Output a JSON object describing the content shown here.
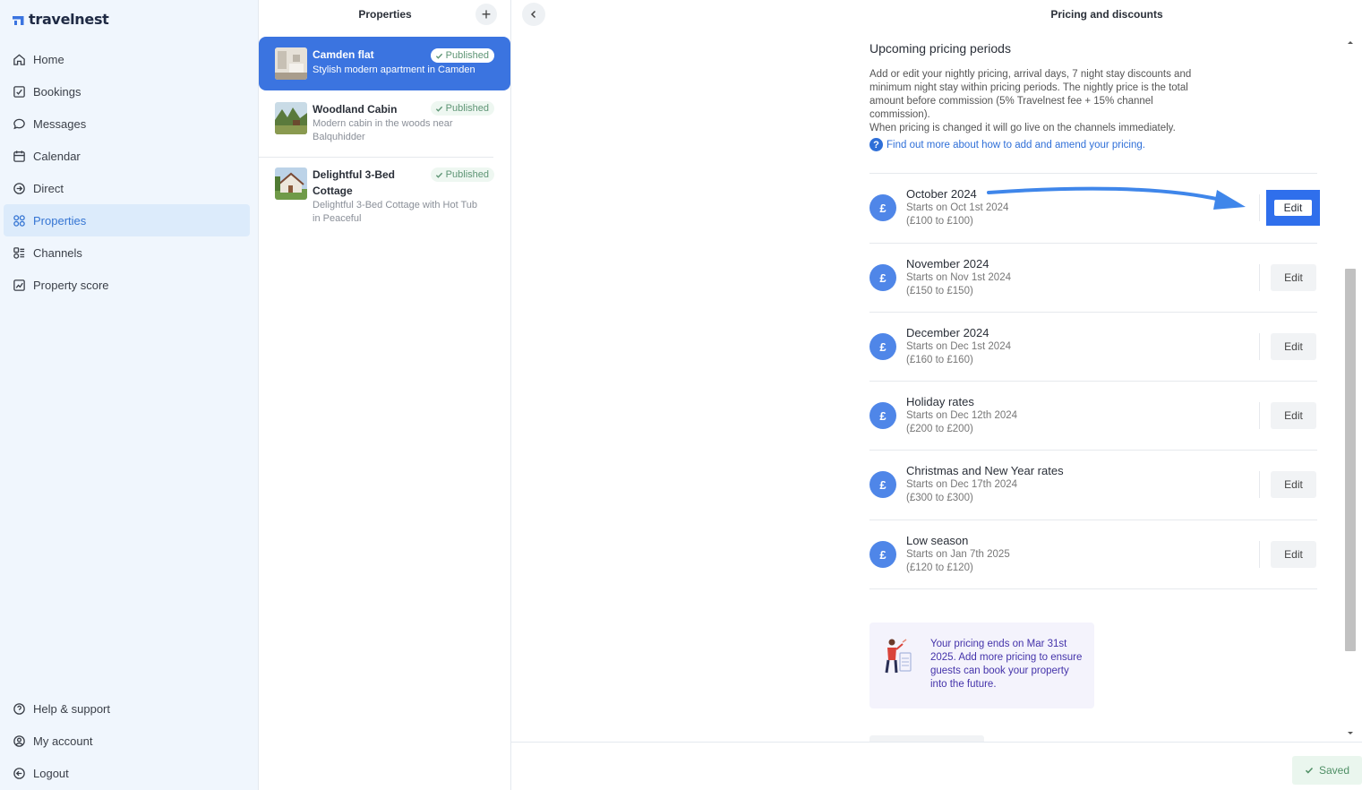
{
  "brand": {
    "name": "travelnest",
    "accent": "#3b74e0"
  },
  "nav": {
    "items": [
      {
        "label": "Home",
        "icon": "home-icon"
      },
      {
        "label": "Bookings",
        "icon": "bookings-icon"
      },
      {
        "label": "Messages",
        "icon": "messages-icon"
      },
      {
        "label": "Calendar",
        "icon": "calendar-icon"
      },
      {
        "label": "Direct",
        "icon": "direct-icon"
      },
      {
        "label": "Properties",
        "icon": "properties-icon",
        "active": true
      },
      {
        "label": "Channels",
        "icon": "channels-icon"
      },
      {
        "label": "Property score",
        "icon": "chart-icon"
      }
    ],
    "bottom": [
      {
        "label": "Help & support",
        "icon": "help-icon"
      },
      {
        "label": "My account",
        "icon": "account-icon"
      },
      {
        "label": "Logout",
        "icon": "logout-icon"
      }
    ]
  },
  "properties": {
    "title": "Properties",
    "add_symbol": "+",
    "items": [
      {
        "name": "Camden flat",
        "desc": "Stylish modern apartment in Camden",
        "status": "Published",
        "selected": true
      },
      {
        "name": "Woodland Cabin",
        "desc": "Modern cabin in the woods near Balquhidder",
        "status": "Published"
      },
      {
        "name": "Delightful 3-Bed Cottage",
        "desc": "Delightful 3-Bed Cottage with Hot Tub in Peaceful",
        "status": "Published"
      }
    ]
  },
  "main": {
    "title": "Pricing and discounts",
    "section_title": "Upcoming pricing periods",
    "intro_1": "Add or edit your nightly pricing, arrival days, 7 night stay discounts and minimum night stay within pricing periods. The nightly price is the total amount before commission (5% Travelnest fee + 15% channel commission).",
    "intro_2": "When pricing is changed it will go live on the channels immediately.",
    "help_link": "Find out more about how to add and amend your pricing.",
    "edit_label": "Edit",
    "currency_symbol": "£",
    "periods": [
      {
        "name": "October 2024",
        "start": "Starts on Oct 1st 2024",
        "range": "(£100 to £100)",
        "highlighted": true
      },
      {
        "name": "November 2024",
        "start": "Starts on Nov 1st 2024",
        "range": "(£150 to £150)"
      },
      {
        "name": "December 2024",
        "start": "Starts on Dec 1st 2024",
        "range": "(£160 to £160)"
      },
      {
        "name": "Holiday rates",
        "start": "Starts on Dec 12th 2024",
        "range": "(£200 to £200)"
      },
      {
        "name": "Christmas and New Year rates",
        "start": "Starts on Dec 17th 2024",
        "range": "(£300 to £300)"
      },
      {
        "name": "Low season",
        "start": "Starts on Jan 7th 2025",
        "range": "(£120 to £120)"
      }
    ],
    "notice": "Your pricing ends on Mar 31st 2025. Add more pricing to ensure guests can book your property into the future.",
    "saved_label": "Saved"
  }
}
